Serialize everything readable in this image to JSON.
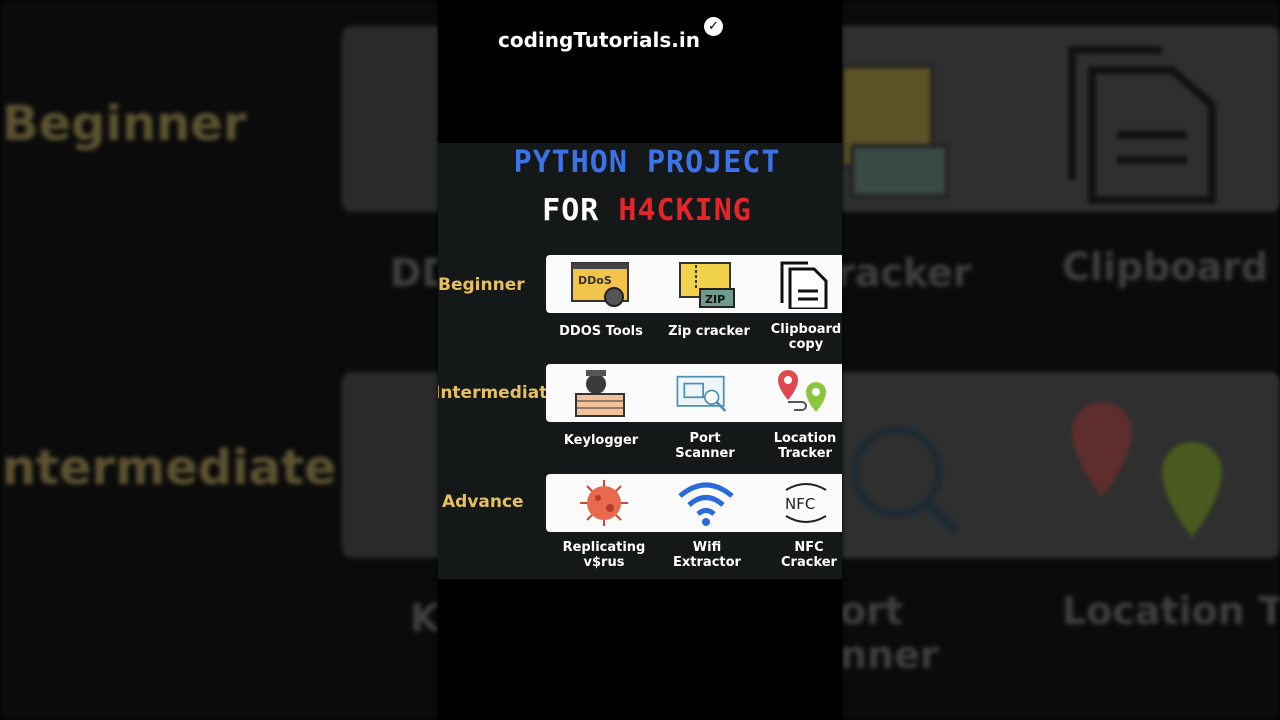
{
  "channel": {
    "name": "codingTutorials.in",
    "verified_icon": "check-badge-icon"
  },
  "poster": {
    "title_line1": "PYTHON PROJECT",
    "title_line2_prefix": "FOR",
    "title_line2_highlight": "H4CKING",
    "colors": {
      "blue": "#3d73e8",
      "red": "#e4262a",
      "gold": "#e8bf5e",
      "bg": "#141819"
    },
    "levels": [
      {
        "name": "Beginner",
        "items": [
          {
            "label": "DDOS Tools",
            "icon": "ddos-icon"
          },
          {
            "label": "Zip cracker",
            "icon": "zip-icon"
          },
          {
            "label": "Clipboard copy",
            "icon": "clipboard-icon"
          }
        ]
      },
      {
        "name": "Intermediate",
        "items": [
          {
            "label": "Keylogger",
            "icon": "keylogger-icon"
          },
          {
            "label": "Port Scanner",
            "icon": "port-scanner-icon"
          },
          {
            "label": "Location Tracker",
            "icon": "location-icon"
          }
        ]
      },
      {
        "name": "Advance",
        "items": [
          {
            "label": "Replicating v$rus",
            "icon": "virus-icon"
          },
          {
            "label": "Wifi Extractor",
            "icon": "wifi-icon"
          },
          {
            "label": "NFC Cracker",
            "icon": "nfc-icon"
          }
        ]
      }
    ]
  },
  "background": {
    "left_labels": [
      "Beginner",
      "Intermediate"
    ],
    "left_partial": [
      "DD",
      "K"
    ],
    "right_labels": [
      "racker",
      "Clipboard copy",
      "ort",
      "nner",
      "Location Tracker"
    ]
  }
}
